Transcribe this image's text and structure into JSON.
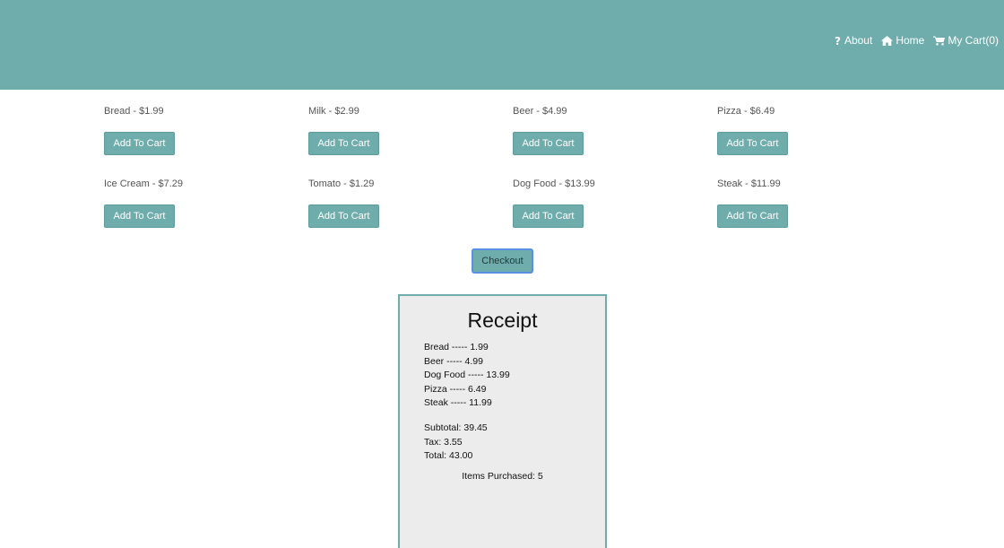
{
  "nav": {
    "about_label": "About",
    "home_label": "Home",
    "cart_label": "My Cart(0)",
    "about_icon": "question-icon",
    "home_icon": "home-icon",
    "cart_icon": "cart-icon"
  },
  "products": [
    {
      "name": "Bread - $1.99",
      "button": "Add To Cart"
    },
    {
      "name": "Milk - $2.99",
      "button": "Add To Cart"
    },
    {
      "name": "Beer - $4.99",
      "button": "Add To Cart"
    },
    {
      "name": "Pizza - $6.49",
      "button": "Add To Cart"
    },
    {
      "name": "Ice Cream - $7.29",
      "button": "Add To Cart"
    },
    {
      "name": "Tomato - $1.29",
      "button": "Add To Cart"
    },
    {
      "name": "Dog Food - $13.99",
      "button": "Add To Cart"
    },
    {
      "name": "Steak - $11.99",
      "button": "Add To Cart"
    }
  ],
  "checkout_label": "Checkout",
  "receipt": {
    "title": "Receipt",
    "items": [
      "Bread ----- 1.99",
      "Beer ----- 4.99",
      "Dog Food ----- 13.99",
      "Pizza ----- 6.49",
      "Steak ----- 11.99"
    ],
    "subtotal": "Subtotal: 39.45",
    "tax": "Tax: 3.55",
    "total": "Total: 43.00",
    "items_purchased": "Items Purchased: 5"
  },
  "colors": {
    "header": "#6fadad",
    "button": "#6fadad",
    "receipt_bg": "#ececec",
    "focus_ring": "#5b8fe3"
  }
}
